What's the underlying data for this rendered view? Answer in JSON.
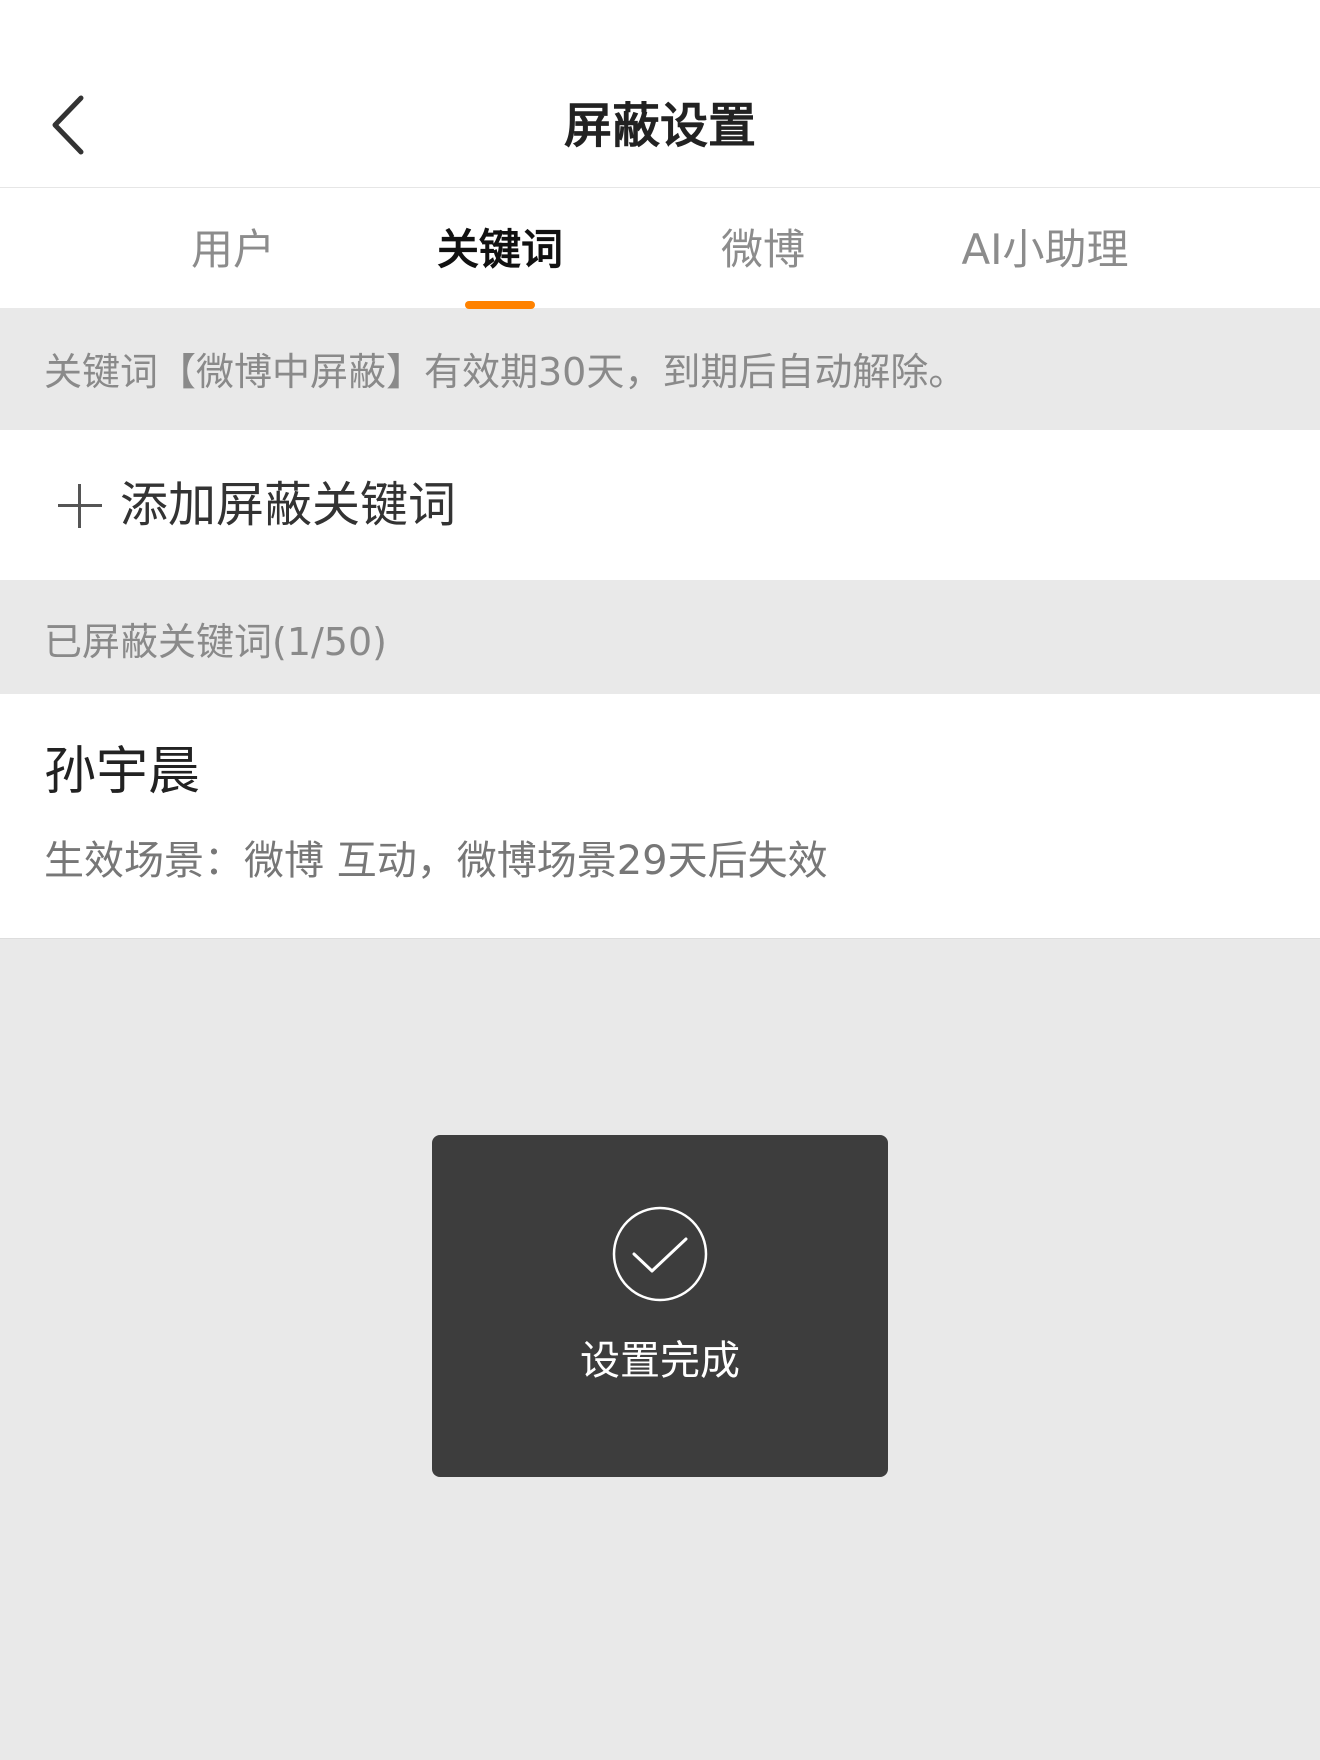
{
  "header": {
    "title": "屏蔽设置",
    "back_icon": "chevron-left-icon"
  },
  "tabs": [
    {
      "label": "用户",
      "active": false
    },
    {
      "label": "关键词",
      "active": true
    },
    {
      "label": "微博",
      "active": false
    },
    {
      "label": "AI小助理",
      "active": false
    }
  ],
  "notice": {
    "text": "关键词【微博中屏蔽】有效期30天，到期后自动解除。"
  },
  "add_keyword": {
    "icon": "plus-icon",
    "label": "添加屏蔽关键词"
  },
  "blocked_section": {
    "label": "已屏蔽关键词(1/50)"
  },
  "keywords": [
    {
      "name": "孙宇晨",
      "description": "生效场景：微博 互动，微博场景29天后失效"
    }
  ],
  "toast": {
    "icon": "check-circle-icon",
    "text": "设置完成"
  },
  "colors": {
    "accent": "#ff8200",
    "background": "#e9e9e9",
    "toast_bg": "#3d3d3d"
  }
}
